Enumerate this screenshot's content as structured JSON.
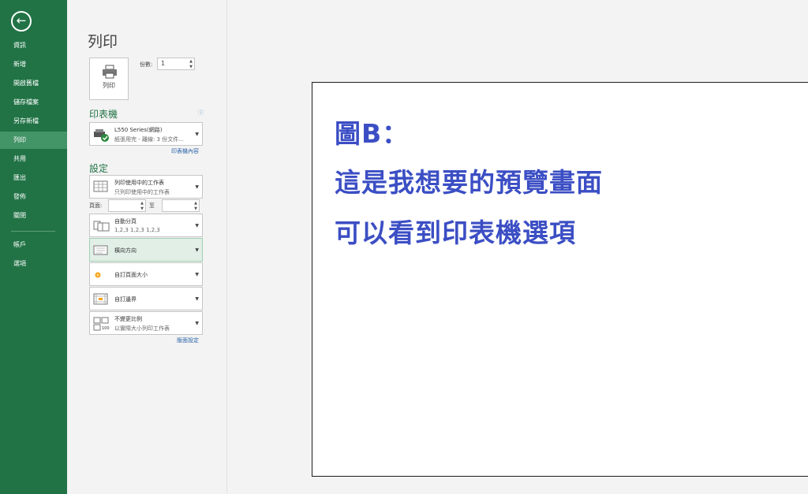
{
  "sidebar": {
    "items": [
      {
        "label": "資訊"
      },
      {
        "label": "新增"
      },
      {
        "label": "開啟舊檔"
      },
      {
        "label": "儲存檔案"
      },
      {
        "label": "另存新檔"
      },
      {
        "label": "列印"
      },
      {
        "label": "共用"
      },
      {
        "label": "匯出"
      },
      {
        "label": "發佈"
      },
      {
        "label": "關閉"
      },
      {
        "label": "帳戶"
      },
      {
        "label": "選項"
      }
    ],
    "active": "列印",
    "accent_color": "#217346"
  },
  "print": {
    "title": "列印",
    "print_button_label": "列印",
    "copies_label": "份數:",
    "copies_value": "1"
  },
  "printer": {
    "heading": "印表機",
    "name": "L550 Series(網路)",
    "status": "紙張用完 - 離線: 3 份文件...",
    "properties_link": "印表機內容"
  },
  "settings": {
    "heading": "設定",
    "scope": {
      "line1": "列印使用中的工作表",
      "line2": "只列印使用中的工作表"
    },
    "pages_label": "頁面:",
    "to_label": "至",
    "collate": {
      "line1": "自動分頁",
      "line2": "1,2,3   1,2,3   1,2,3"
    },
    "orientation": "橫向方向",
    "paper_size": "自訂頁面大小",
    "margins": "自訂邊界",
    "scaling": {
      "line1": "不變更比例",
      "line2": "以實際大小列印工作表"
    },
    "page_setup_link": "版面設定"
  },
  "preview": {
    "line1": "圖B：",
    "line2": "這是我想要的預覽畫面",
    "line3": "可以看到印表機選項",
    "text_color": "#3b4ec4"
  }
}
